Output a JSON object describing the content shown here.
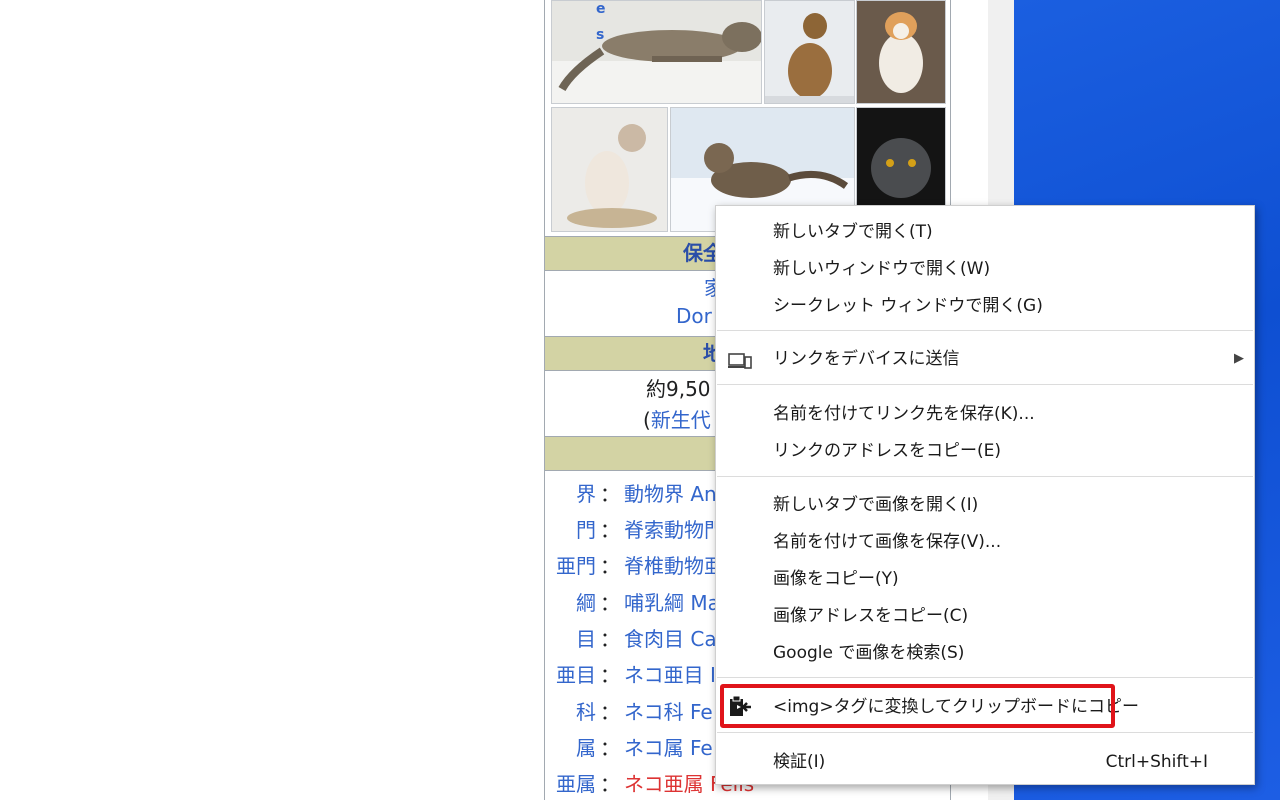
{
  "infobox": {
    "frag_letters": [
      "e",
      "s"
    ],
    "status_header": "保全",
    "status_line1": "家",
    "status_line2": "Dor",
    "range_header": "地",
    "fossil_line1": "約9,50",
    "fossil_line2_paren": "(",
    "fossil_line2_link": "新生代",
    "taxonomy": [
      {
        "rank": "界",
        "value": "動物界 An",
        "style": "link"
      },
      {
        "rank": "門",
        "value": "脊索動物門",
        "style": "link"
      },
      {
        "rank": "亜門",
        "value": "脊椎動物亜",
        "style": "link"
      },
      {
        "rank": "綱",
        "value": "哺乳綱 Ma",
        "style": "link"
      },
      {
        "rank": "目",
        "value": "食肉目 Ca",
        "style": "link"
      },
      {
        "rank": "亜目",
        "value": "ネコ亜目 I",
        "style": "link"
      },
      {
        "rank": "科",
        "value": "ネコ科 Fe",
        "style": "link"
      },
      {
        "rank": "属",
        "value": "ネコ属 Fe",
        "style": "link"
      },
      {
        "rank": "亜属",
        "value": "ネコ亜属 Felis",
        "style": "redlink"
      }
    ]
  },
  "context_menu": {
    "items": [
      {
        "label": "新しいタブで開く(T)"
      },
      {
        "label": "新しいウィンドウで開く(W)"
      },
      {
        "label": "シークレット ウィンドウで開く(G)"
      },
      {
        "label": "リンクをデバイスに送信",
        "icon": "devices-icon",
        "submenu": true
      },
      {
        "label": "名前を付けてリンク先を保存(K)..."
      },
      {
        "label": "リンクのアドレスをコピー(E)"
      },
      {
        "label": "新しいタブで画像を開く(I)"
      },
      {
        "label": "名前を付けて画像を保存(V)..."
      },
      {
        "label": "画像をコピー(Y)"
      },
      {
        "label": "画像アドレスをコピー(C)"
      },
      {
        "label": "Google で画像を検索(S)"
      },
      {
        "label": "<img>タグに変換してクリップボードにコピー",
        "icon": "clipboard-extension-icon",
        "highlighted": true
      },
      {
        "label": "検証(I)",
        "shortcut": "Ctrl+Shift+I"
      }
    ]
  },
  "colors": {
    "highlight_border": "#e0141a",
    "desktop_blue": "#0e4fd2",
    "link": "#3366cc",
    "header_bg": "#d3d3a4"
  }
}
